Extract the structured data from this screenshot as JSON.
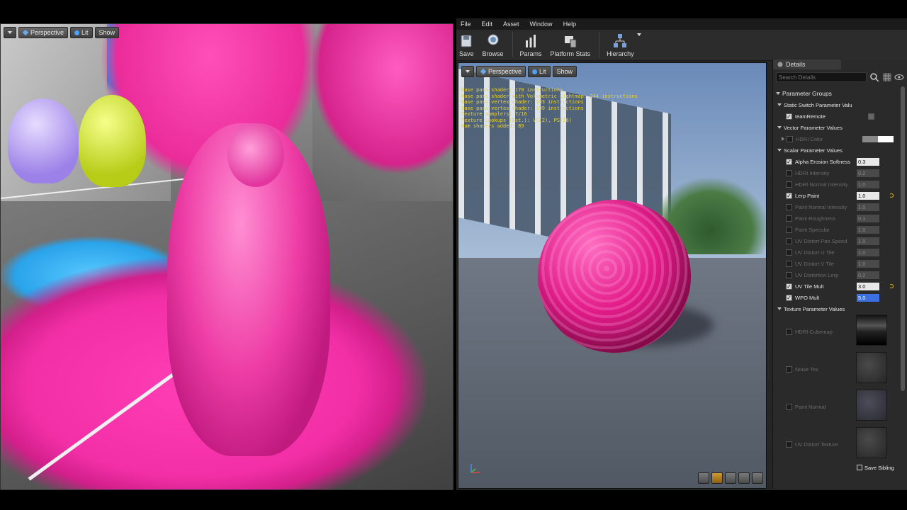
{
  "left_viewport": {
    "mode": "Perspective",
    "lighting": "Lit",
    "show": "Show"
  },
  "editor": {
    "menu": [
      "File",
      "Edit",
      "Asset",
      "Window",
      "Help"
    ],
    "toolbar": {
      "save": "Save",
      "browse": "Browse",
      "params": "Params",
      "platform_stats": "Platform Stats",
      "hierarchy": "Hierarchy"
    },
    "viewport": {
      "mode": "Perspective",
      "lighting": "Lit",
      "show": "Show",
      "stats": [
        "Base pass shader: 170 instructions",
        "Base pass shader with Volumetric Lightmap: 244 instructions",
        "Base pass vertex shader: 103 instructions",
        "Base pass vertex shader: 199 instructions",
        "Texture samplers: 7/16",
        "Texture Lookups (Est.): VS(2), PS(16)",
        "Num shaders added: 89"
      ]
    }
  },
  "details": {
    "tab": "Details",
    "search_placeholder": "Search Details",
    "parameter_groups": "Parameter Groups",
    "static_switch_header": "Static Switch Parameter Valu",
    "vector_header": "Vector Parameter Values",
    "scalar_header": "Scalar Parameter Values",
    "texture_header": "Texture Parameter Values",
    "static_switches": [
      {
        "name": "teamRemote",
        "checked": true
      }
    ],
    "vectors": [
      {
        "name": "HDRI Color",
        "checked": false
      }
    ],
    "scalars": [
      {
        "name": "Alpha Erosion Softness",
        "value": "0.3",
        "checked": true
      },
      {
        "name": "HDRI Intensity",
        "value": "0.2",
        "checked": false
      },
      {
        "name": "HDRI Normal Intensity",
        "value": "1.0",
        "checked": false
      },
      {
        "name": "Lerp Paint",
        "value": "1.0",
        "checked": true
      },
      {
        "name": "Paint Normal Intensity",
        "value": "1.0",
        "checked": false
      },
      {
        "name": "Paint Roughness",
        "value": "0.1",
        "checked": false
      },
      {
        "name": "Paint Specular",
        "value": "1.0",
        "checked": false
      },
      {
        "name": "UV Distort Pan Speed",
        "value": "1.0",
        "checked": false
      },
      {
        "name": "UV Distort U Tile",
        "value": "1.0",
        "checked": false
      },
      {
        "name": "UV Distort V Tile",
        "value": "1.0",
        "checked": false
      },
      {
        "name": "UV Distortion Lerp",
        "value": "0.2",
        "checked": false
      },
      {
        "name": "UV Tile Mult",
        "value": "3.0",
        "checked": true
      },
      {
        "name": "WPO Mult",
        "value": "5.0",
        "checked": true
      }
    ],
    "textures": [
      {
        "name": "HDRI Cubemap",
        "checked": false
      },
      {
        "name": "Noise Tex",
        "checked": false
      },
      {
        "name": "Paint Normal",
        "checked": false
      },
      {
        "name": "UV Distort Texture",
        "checked": false
      }
    ],
    "save_sibling": "Save Sibling"
  },
  "colors": {
    "accent_pink": "#e8259a",
    "stats_yellow": "#e8d33a",
    "selection_blue": "#3c6fe0"
  }
}
